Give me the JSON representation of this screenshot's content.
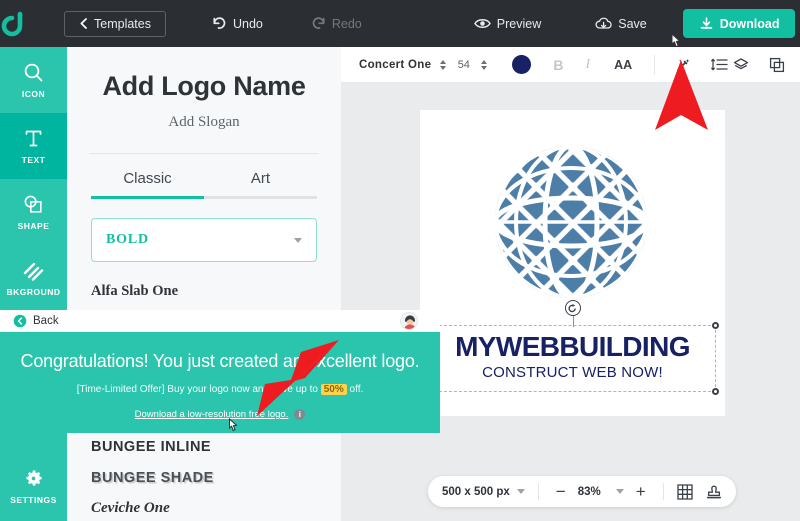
{
  "topbar": {
    "logo_icon": "brand-logo-icon",
    "templates_label": "Templates",
    "undo_label": "Undo",
    "redo_label": "Redo",
    "preview_label": "Preview",
    "save_label": "Save",
    "download_label": "Download",
    "background_color": "#2b2f33",
    "download_color": "#12bfa0"
  },
  "rail": {
    "items": [
      {
        "label": "ICON",
        "icon": "magnifier-icon",
        "active": false
      },
      {
        "label": "TEXT",
        "icon": "text-t-icon",
        "active": true
      },
      {
        "label": "SHAPE",
        "icon": "shapes-icon",
        "active": false
      },
      {
        "label": "BKGROUND",
        "icon": "hatch-icon",
        "active": false
      }
    ],
    "settings": {
      "label": "SETTINGS",
      "icon": "gear-icon"
    },
    "color": "#2bc4ad",
    "active_color": "#00b5a0"
  },
  "panel": {
    "logo_name": "Add Logo Name",
    "slogan": "Add Slogan",
    "tabs": [
      {
        "label": "Classic",
        "active": true
      },
      {
        "label": "Art",
        "active": false
      }
    ],
    "weight_select": {
      "value": "BOLD",
      "caret": "chevron-down-icon"
    },
    "fonts": [
      {
        "name": "Alfa Slab One",
        "style": "alfa"
      },
      {
        "name": "BUNGEE INLINE",
        "style": "bungee-inline"
      },
      {
        "name": "BUNGEE SHADE",
        "style": "bungee-shade"
      },
      {
        "name": "Ceviche One",
        "style": "ceviche"
      }
    ]
  },
  "canvas_toolbar": {
    "font_family": "Concert One",
    "font_size": "54",
    "color_swatch": "#172163",
    "bold_label": "B",
    "italic_label": "I",
    "case_label": "AA",
    "effects_icon": "magic-wand-icon",
    "spacing_icon": "line-spacing-icon",
    "layers_icon": "layers-icon",
    "duplicate_icon": "duplicate-icon"
  },
  "canvas": {
    "logo_name": "MYWEBBUILDING",
    "logo_slogan": "CONSTRUCT WEB NOW!",
    "logo_color": "#172163",
    "globe_color": "#4d7ea8",
    "rotate_icon": "rotate-handle-icon"
  },
  "statusbar": {
    "canvas_size": "500 x 500 px",
    "size_caret": "chevron-down-icon",
    "minus_label": "−",
    "zoom": "83%",
    "zoom_caret": "chevron-down-icon",
    "plus_label": "+",
    "grid_icon": "grid-icon",
    "snapshot_icon": "stamp-icon"
  },
  "overlay": {
    "back_label": "Back",
    "back_icon": "back-circle-icon",
    "avatar_icon": "user-avatar-icon",
    "headline": "Congratulations! You just created an excellent logo.",
    "subline_before": "[Time-Limited Offer] Buy your logo now and save up to ",
    "subline_pct": "50%",
    "subline_after": " off.",
    "free_link": "Download a low-resolution free logo.",
    "info_icon": "info-icon",
    "background_color": "#2bc4ad"
  },
  "annotation": {
    "arrow_color": "#ee1c21",
    "arrow_count": "2"
  }
}
